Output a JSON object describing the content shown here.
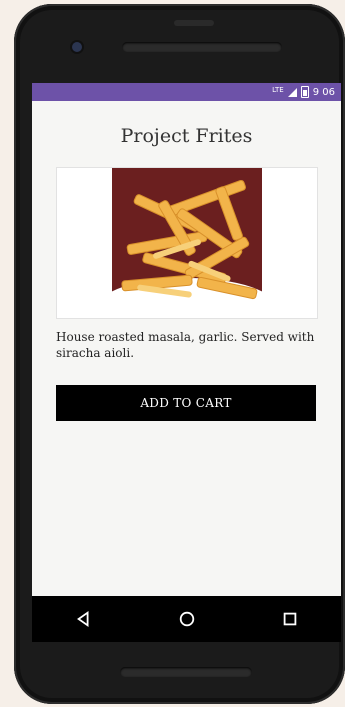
{
  "status": {
    "time": "9 06",
    "network": "LTE"
  },
  "product": {
    "title": "Project Frites",
    "description": "House roasted masala, garlic. Served with siracha aioli.",
    "add_to_cart_label": "ADD TO CART"
  },
  "colors": {
    "status_bar": "#6d52a8",
    "button": "#000000",
    "screen_bg": "#f6f6f4"
  },
  "icons": {
    "back": "back-icon",
    "home": "home-icon",
    "recents": "recents-icon"
  }
}
